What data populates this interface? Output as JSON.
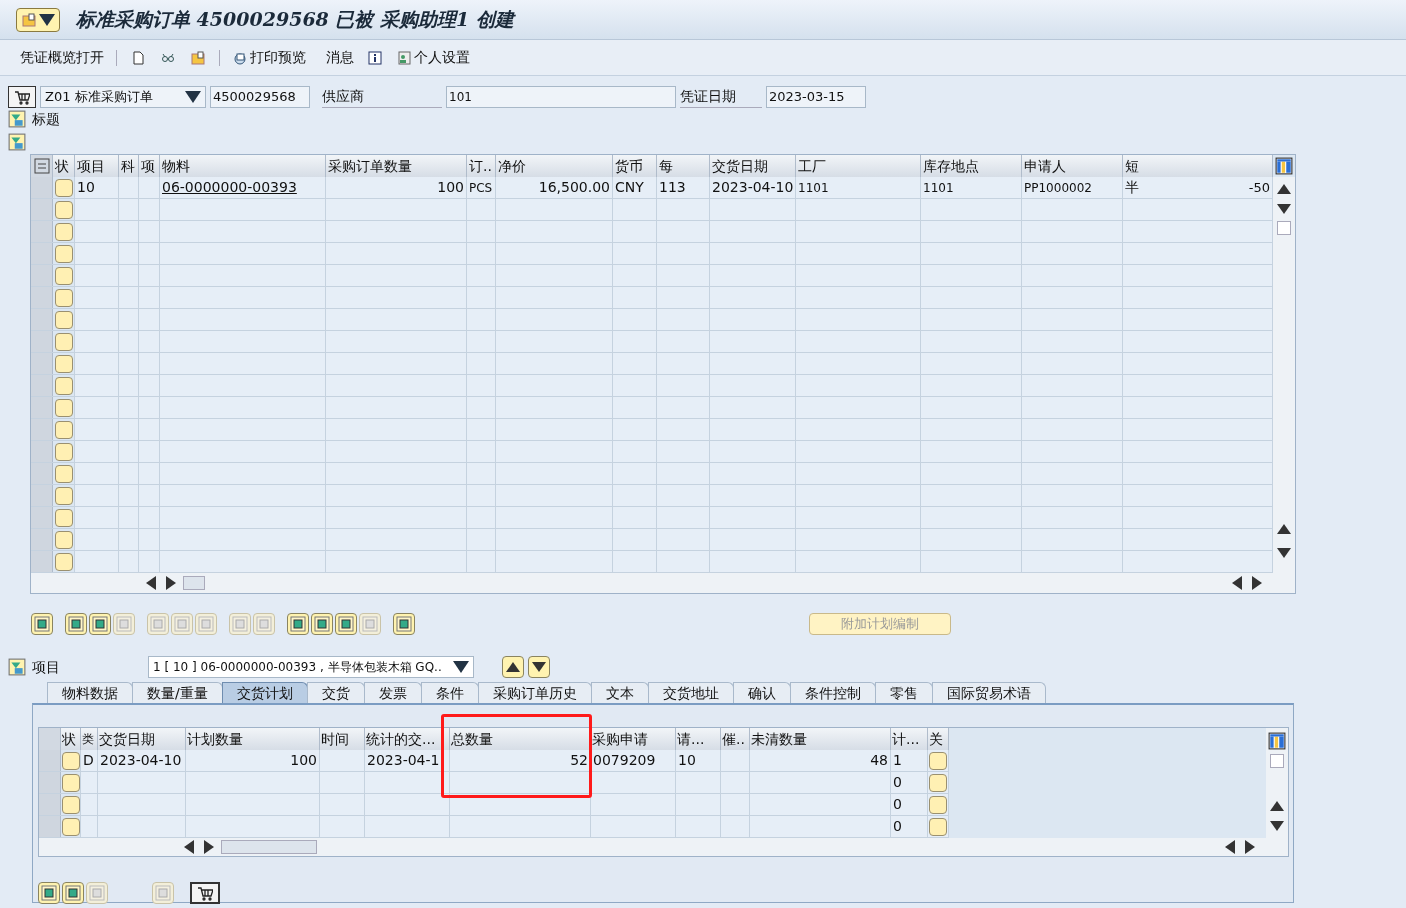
{
  "window": {
    "title": "标准采购订单 4500029568 已被 采购助理1 创建"
  },
  "toolbar": {
    "overview_button": "凭证概览打开",
    "print_preview": "打印预览",
    "messages": "消息",
    "personal_settings": "个人设置"
  },
  "header": {
    "doc_type": "Z01 标准采购订单",
    "po_number": "4500029568",
    "supplier_label": "供应商",
    "supplier_value": "101",
    "date_label": "凭证日期",
    "date_value": "2023-03-15",
    "header_label": "标题"
  },
  "items_table": {
    "columns": [
      "状",
      "项目",
      "科",
      "项",
      "物料",
      "采购订单数量",
      "订..",
      "净价",
      "货币",
      "每",
      "交货日期",
      "工厂",
      "库存地点",
      "申请人",
      "短"
    ],
    "rows": [
      {
        "item": "10",
        "material": "06-0000000-00393",
        "quantity": "100",
        "unit": "PCS",
        "net_price": "16,500.00",
        "currency": "CNY",
        "per": "113",
        "delivery_date": "2023-04-10",
        "plant": "1101",
        "storage_location": "1101",
        "requisitioner": "PP1000002",
        "short_text": "半",
        "short_text_tail": "-50"
      }
    ]
  },
  "additional_planning_button": {
    "label": "附加计划编制",
    "disabled": true
  },
  "item_selector": {
    "label": "项目",
    "value": "1 [ 10 ] 06-0000000-00393 , 半导体包装木箱 GQ.."
  },
  "tabs": [
    {
      "label": "物料数据",
      "selected": false
    },
    {
      "label": "数量/重量",
      "selected": false
    },
    {
      "label": "交货计划",
      "selected": true
    },
    {
      "label": "交货",
      "selected": false
    },
    {
      "label": "发票",
      "selected": false
    },
    {
      "label": "条件",
      "selected": false
    },
    {
      "label": "采购订单历史",
      "selected": false
    },
    {
      "label": "文本",
      "selected": false
    },
    {
      "label": "交货地址",
      "selected": false
    },
    {
      "label": "确认",
      "selected": false
    },
    {
      "label": "条件控制",
      "selected": false
    },
    {
      "label": "零售",
      "selected": false
    },
    {
      "label": "国际贸易术语",
      "selected": false
    }
  ],
  "schedule_table": {
    "columns": [
      "状",
      "类",
      "交货日期",
      "计划数量",
      "时间",
      "统计的交...",
      "总数量",
      "采购申请",
      "请...",
      "催..",
      "未清数量",
      "计...",
      "关"
    ],
    "rows": [
      {
        "category": "D",
        "delivery_date": "2023-04-10",
        "scheduled_qty": "100",
        "stat_date": "2023-04-1",
        "total_qty": "52",
        "requisition": "0079209",
        "req_item": "10",
        "open_qty": "48",
        "counter": "1",
        "closed": false
      },
      {
        "counter": "0",
        "closed": false
      },
      {
        "counter": "0",
        "closed": false
      },
      {
        "counter": "0",
        "closed": false
      }
    ]
  }
}
